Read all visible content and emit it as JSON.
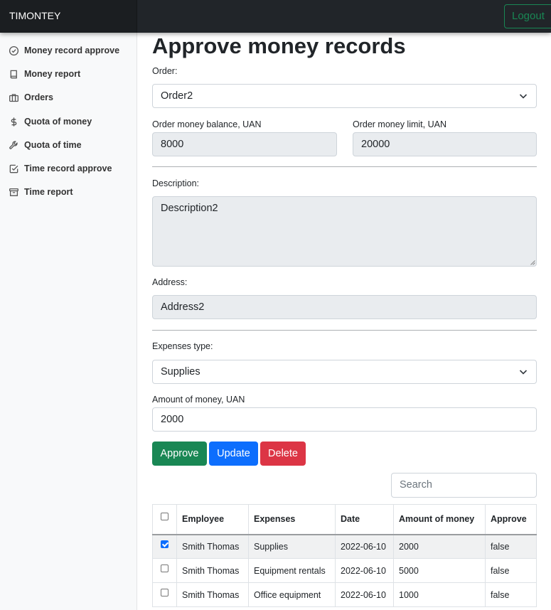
{
  "navbar": {
    "brand": "TIMONTEY",
    "logout_label": "Logout"
  },
  "sidebar": {
    "items": [
      {
        "label": "Money record approve",
        "icon": "check-circle-icon"
      },
      {
        "label": "Money report",
        "icon": "book-icon"
      },
      {
        "label": "Orders",
        "icon": "briefcase-icon"
      },
      {
        "label": "Quota of money",
        "icon": "dollar-icon"
      },
      {
        "label": "Quota of time",
        "icon": "wrench-icon"
      },
      {
        "label": "Time record approve",
        "icon": "check-square-icon"
      },
      {
        "label": "Time report",
        "icon": "archive-icon"
      }
    ]
  },
  "page": {
    "title": "Approve money records"
  },
  "form": {
    "order_label": "Order:",
    "order_value": "Order2",
    "balance_label": "Order money balance, UAN",
    "balance_value": "8000",
    "limit_label": "Order money limit, UAN",
    "limit_value": "20000",
    "description_label": "Description:",
    "description_value": "Description2",
    "address_label": "Address:",
    "address_value": "Address2",
    "expenses_type_label": "Expenses type:",
    "expenses_type_value": "Supplies",
    "amount_label": "Amount of money, UAN",
    "amount_value": "2000"
  },
  "actions": {
    "approve": "Approve",
    "update": "Update",
    "delete": "Delete"
  },
  "search": {
    "placeholder": "Search"
  },
  "table": {
    "headers": [
      "Employee",
      "Expenses",
      "Date",
      "Amount of money",
      "Approve"
    ],
    "rows": [
      {
        "selected": true,
        "employee": "Smith Thomas",
        "expenses": "Supplies",
        "date": "2022-06-10",
        "amount": "2000",
        "approve": "false"
      },
      {
        "selected": false,
        "employee": "Smith Thomas",
        "expenses": "Equipment rentals",
        "date": "2022-06-10",
        "amount": "5000",
        "approve": "false"
      },
      {
        "selected": false,
        "employee": "Smith Thomas",
        "expenses": "Office equipment",
        "date": "2022-06-10",
        "amount": "1000",
        "approve": "false"
      }
    ]
  },
  "colors": {
    "navbar": "#212529",
    "green": "#198754",
    "blue": "#0d6efd",
    "red": "#dc3545",
    "sidebar": "#f8f9fa"
  }
}
